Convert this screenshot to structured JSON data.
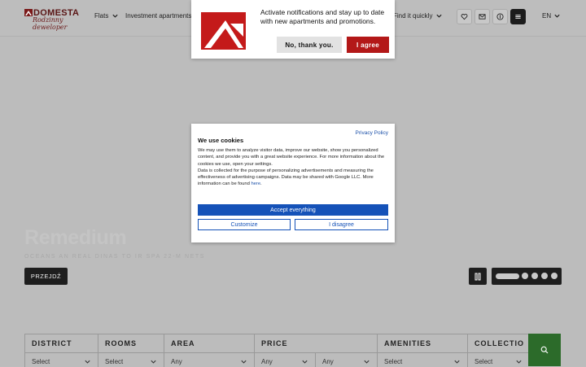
{
  "header": {
    "logo_text": "DOMESTA",
    "logo_sub": "Rodzinny deweloper",
    "nav": [
      "Flats",
      "Investment apartments",
      "Find it quickly"
    ],
    "lang": "EN"
  },
  "notification": {
    "text": "Activate notifications and stay up to date with new apartments and promotions.",
    "no_label": "No, thank you.",
    "yes_label": "I agree"
  },
  "cookies": {
    "privacy_link": "Privacy Policy",
    "title": "We use cookies",
    "body_1": "We may use them to analyze visitor data, improve our website, show you personalized content, and provide you with a great website experience. For more information about the cookies we use, open your settings.",
    "body_2": "Data is collected for the purpose of personalizing advertisements and measuring the effectiveness of advertising campaigns. Data may be shared with Google LLC. More information can be found",
    "here_link": "here",
    "accept_label": "Accept everything",
    "customize_label": "Customize",
    "disagree_label": "I disagree"
  },
  "hero": {
    "title": "Remedium",
    "subtitle": "OCEANS AN REAL DINAS TO IR SPA 22-M NETS",
    "goto_label": "PRZEJDŹ"
  },
  "filters": {
    "district": {
      "label": "DISTRICT",
      "value": "Select"
    },
    "rooms": {
      "label": "ROOMS",
      "value": "Select"
    },
    "area": {
      "label": "AREA",
      "value": "Any"
    },
    "price": {
      "label": "PRICE",
      "from": "Any",
      "to": "Any"
    },
    "amenities": {
      "label": "AMENITIES",
      "value": "Select"
    },
    "collection": {
      "label": "COLLECTIO",
      "value": "Select"
    }
  },
  "colors": {
    "brand_red": "#b31818",
    "accept_blue": "#1552b8",
    "search_green": "#2c6b2a"
  }
}
